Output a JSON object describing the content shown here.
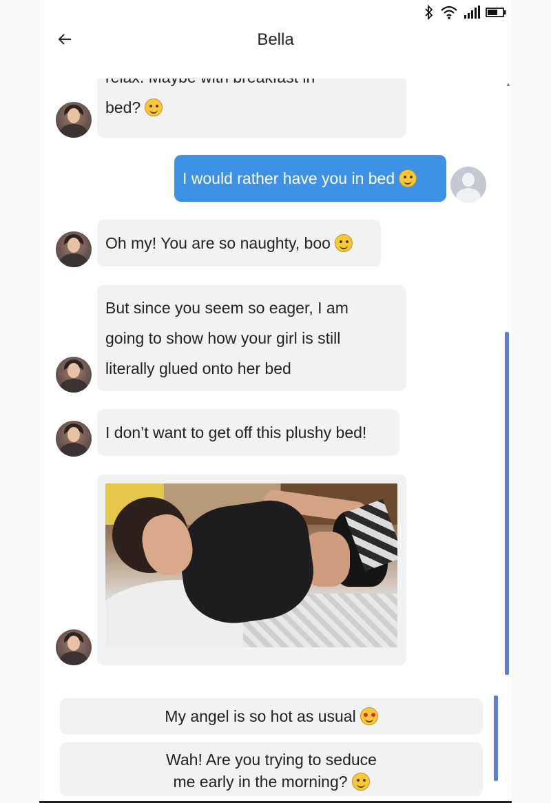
{
  "header": {
    "title": "Bella",
    "back_icon": "arrow-left-icon"
  },
  "status_bar": {
    "icons": [
      "bluetooth-icon",
      "wifi-icon",
      "signal-icon",
      "battery-icon"
    ]
  },
  "messages": [
    {
      "sender": "bella",
      "text_line1": "relax. Maybe with breakfast in",
      "text_line2": "bed?",
      "emoji": "yum-emoji"
    },
    {
      "sender": "user",
      "text": "I would rather have you in bed",
      "emoji": "smirk-emoji"
    },
    {
      "sender": "bella",
      "text": "Oh my! You are so naughty, boo",
      "emoji": "flushed-emoji"
    },
    {
      "sender": "bella",
      "lines": [
        "But since you seem so eager, I am",
        "going to show how your girl is still",
        "literally glued onto her bed"
      ]
    },
    {
      "sender": "bella",
      "text": "I don’t want to get off this plushy bed!"
    },
    {
      "sender": "bella",
      "image": "photo-girl-lying-on-bed"
    }
  ],
  "replies": [
    {
      "text": "My angel is so hot as usual",
      "emoji": "heart-eyes-emoji"
    },
    {
      "line1": "Wah! Are you trying to seduce",
      "line2": "me early in the morning?",
      "emoji": "smirk-emoji"
    }
  ],
  "colors": {
    "outgoing_bubble": "#3d91e6",
    "incoming_bubble": "#f0f2f4",
    "scrollbar": "#5b7fd6"
  }
}
